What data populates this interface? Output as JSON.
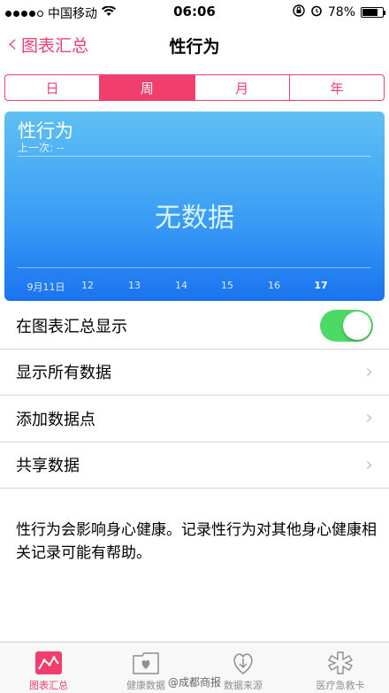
{
  "status_bar": {
    "carrier": "中国移动",
    "time": "06:06",
    "battery": "78%",
    "battery_level": 0.78
  },
  "nav": {
    "back_label": "图表汇总",
    "title": "性行为"
  },
  "segments": [
    "日",
    "周",
    "月",
    "年"
  ],
  "selected_segment": "周",
  "chart": {
    "title": "性行为",
    "subtitle": "上一次: --",
    "empty_text": "无数据",
    "ticks": [
      "9月11日",
      "12",
      "13",
      "14",
      "15",
      "16",
      "17"
    ],
    "current_tick": "17"
  },
  "list": {
    "show_in_dashboard": "在图表汇总显示",
    "show_all_data": "显示所有数据",
    "add_data_point": "添加数据点",
    "share_data": "共享数据"
  },
  "toggle_on": true,
  "description": "性行为会影响身心健康。记录性行为对其他身心健康相关记录可能有帮助。",
  "tabs": [
    "图表汇总",
    "健康数据",
    "数据来源",
    "医疗急救卡"
  ],
  "active_tab": "图表汇总",
  "watermark": "@成都商报",
  "colors": {
    "accent": "#f13e6c",
    "toggle": "#4cd964",
    "chart_top": "#5fc0f4",
    "chart_bottom": "#1a74f0"
  }
}
